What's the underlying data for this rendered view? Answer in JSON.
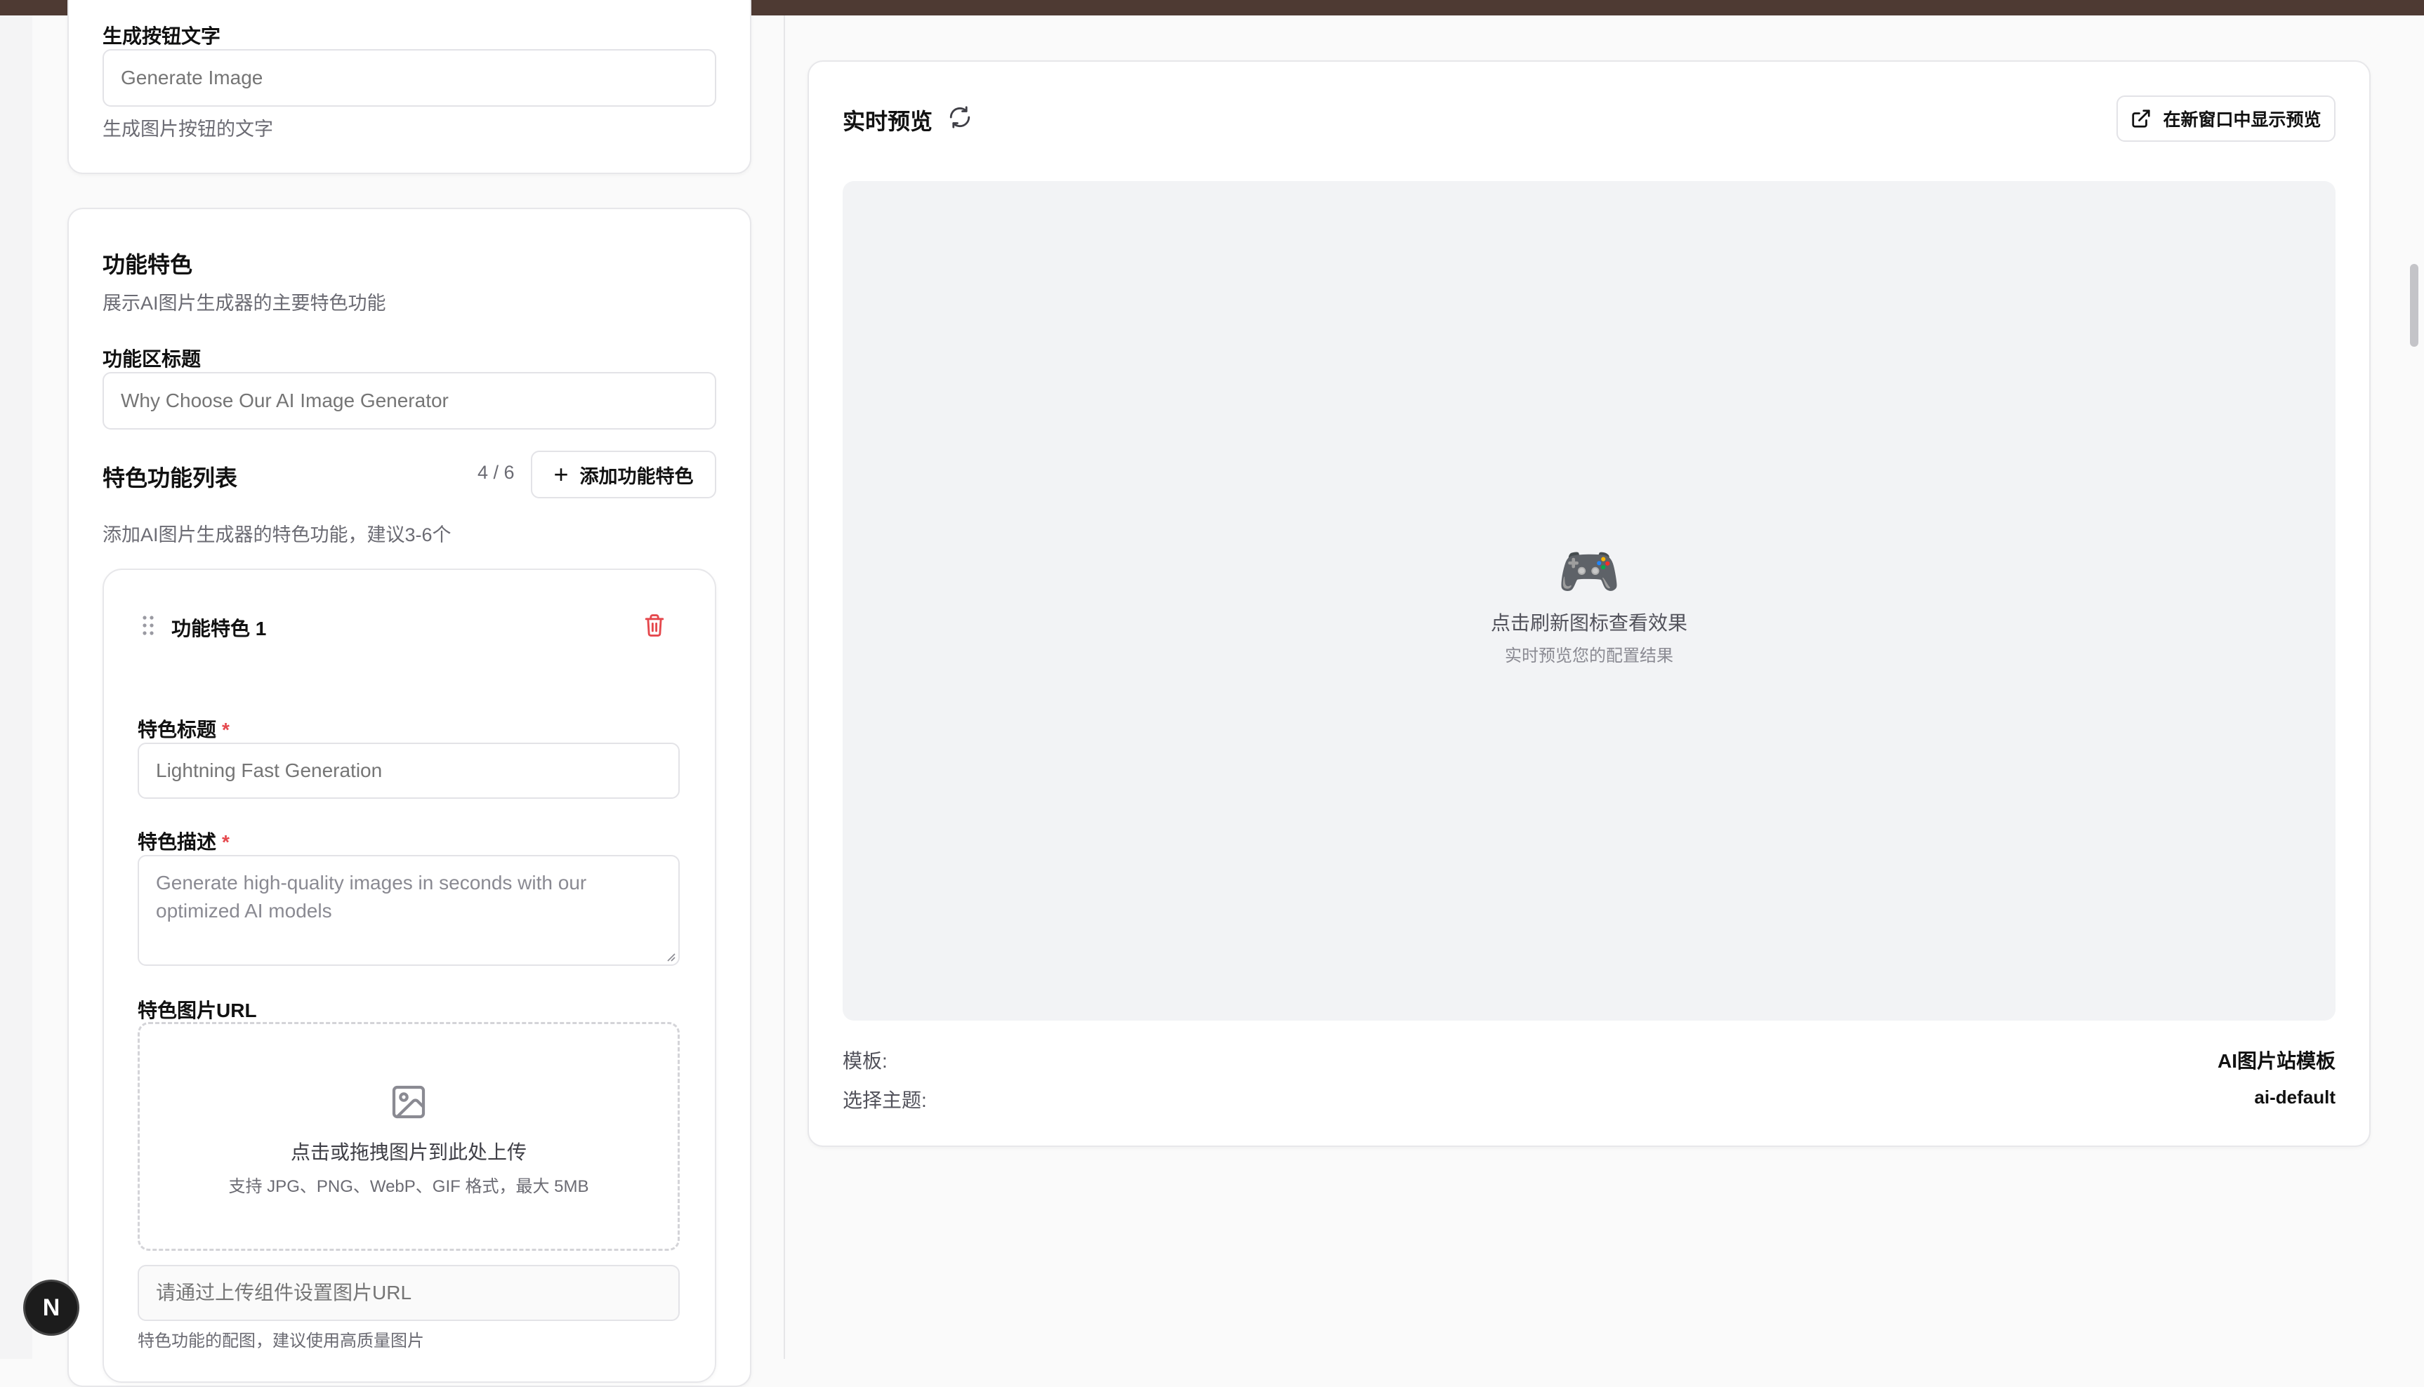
{
  "generate_button": {
    "label": "生成按钮文字",
    "placeholder": "Generate Image",
    "help": "生成图片按钮的文字"
  },
  "features": {
    "title": "功能特色",
    "subtitle": "展示AI图片生成器的主要特色功能",
    "section_title_label": "功能区标题",
    "section_title_placeholder": "Why Choose Our AI Image Generator",
    "list_title": "特色功能列表",
    "count": "4 / 6",
    "add_button": "添加功能特色",
    "list_help": "添加AI图片生成器的特色功能，建议3-6个",
    "item": {
      "name": "功能特色 1",
      "title_label": "特色标题",
      "title_required": "*",
      "title_placeholder": "Lightning Fast Generation",
      "desc_label": "特色描述",
      "desc_required": "*",
      "desc_placeholder": "Generate high-quality images in seconds with our optimized AI models",
      "image_label": "特色图片URL",
      "upload_text": "点击或拖拽图片到此处上传",
      "upload_hint": "支持 JPG、PNG、WebP、GIF 格式，最大 5MB",
      "url_placeholder": "请通过上传组件设置图片URL",
      "image_help": "特色功能的配图，建议使用高质量图片"
    }
  },
  "preview": {
    "title": "实时预览",
    "open_new_window": "在新窗口中显示预览",
    "emoji": "🎮",
    "main_text": "点击刷新图标查看效果",
    "sub_text": "实时预览您的配置结果",
    "template_label": "模板:",
    "template_value": "AI图片站模板",
    "theme_label": "选择主题:",
    "theme_value": "ai-default"
  },
  "avatar_letter": "N",
  "colors": {
    "accent_red": "#e5484d",
    "topbar": "#4e3a33"
  }
}
